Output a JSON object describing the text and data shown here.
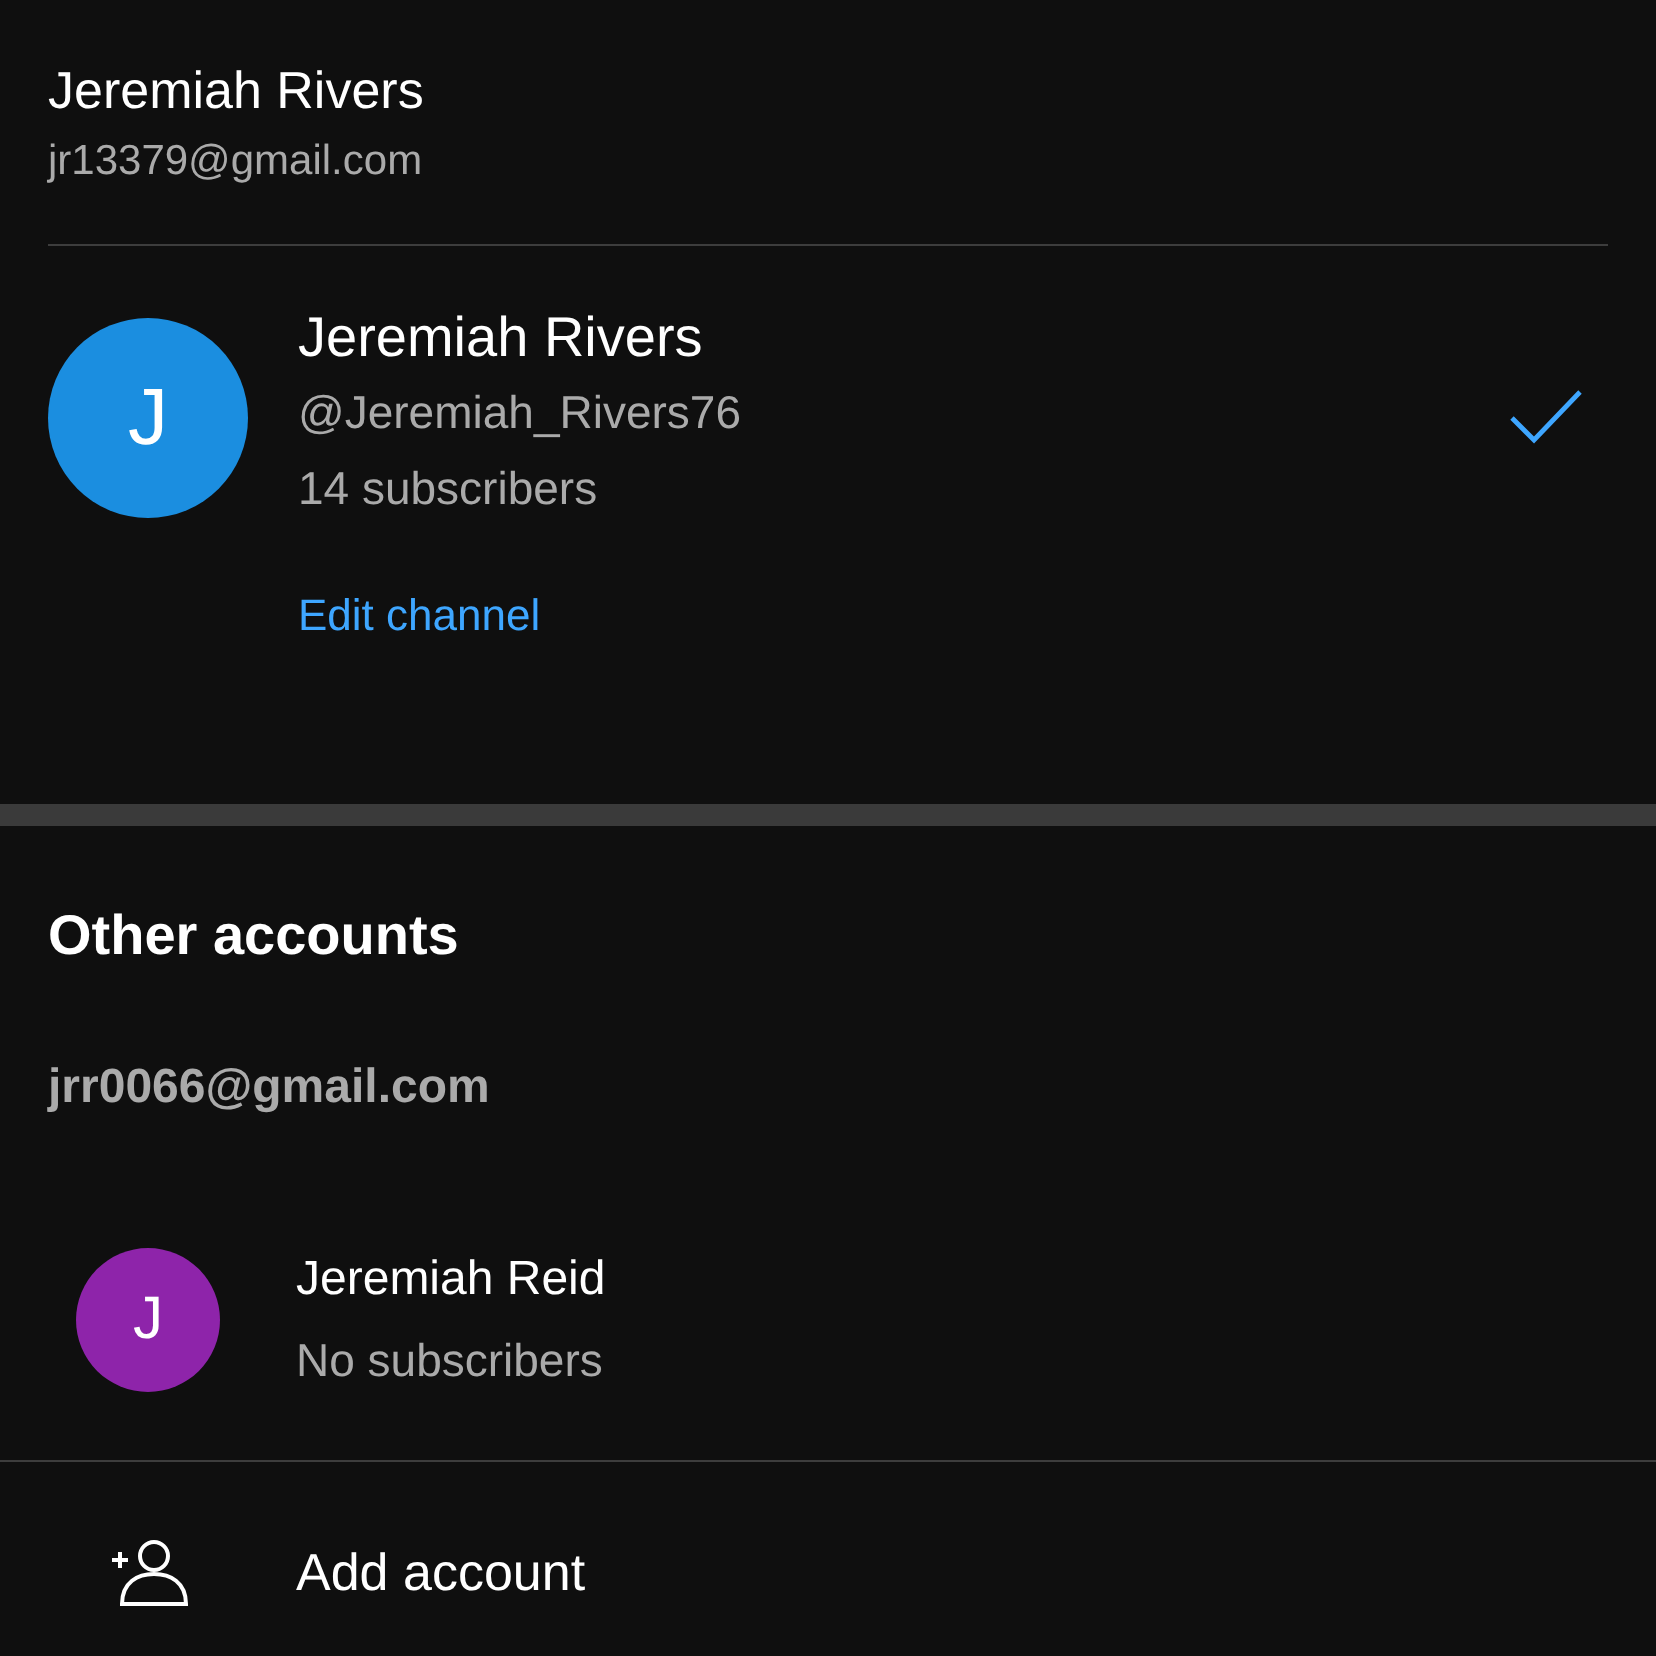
{
  "account": {
    "name": "Jeremiah Rivers",
    "email": "jr13379@gmail.com"
  },
  "current_channel": {
    "letter": "J",
    "color": "#1b8ee0",
    "name": "Jeremiah Rivers",
    "handle": "@Jeremiah_Rivers76",
    "subscribers": "14 subscribers",
    "selected": true,
    "edit_link": "Edit channel"
  },
  "other_accounts": {
    "title": "Other accounts",
    "groups": [
      {
        "email": "jrr0066@gmail.com",
        "channels": [
          {
            "letter": "J",
            "color": "#8e24aa",
            "name": "Jeremiah Reid",
            "subscribers": "No subscribers",
            "selected": false
          }
        ]
      }
    ]
  },
  "add_account": {
    "label": "Add account"
  }
}
